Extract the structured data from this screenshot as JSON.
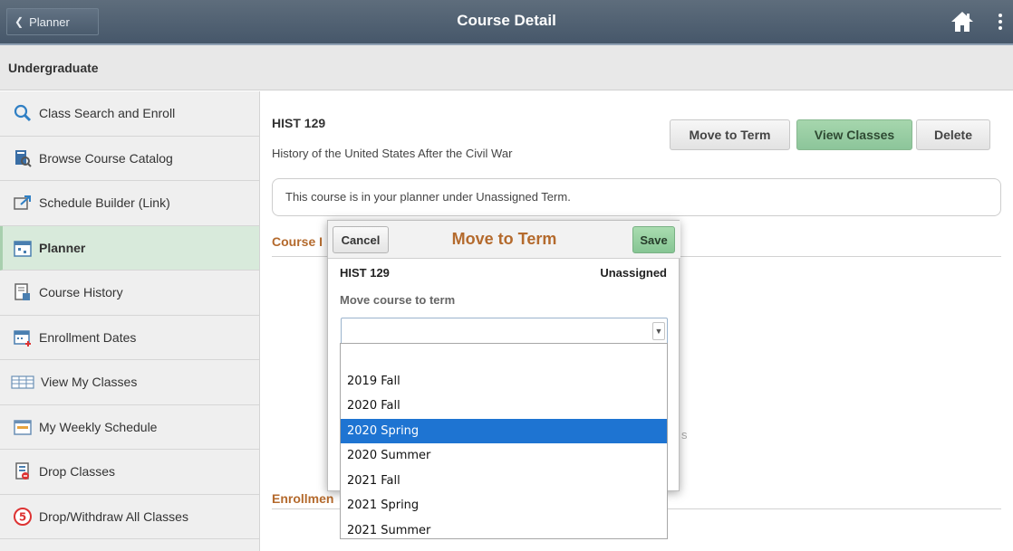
{
  "header": {
    "back_label": "Planner",
    "title": "Course Detail"
  },
  "subheader": {
    "label": "Undergraduate"
  },
  "sidebar": {
    "items": [
      {
        "label": "Class Search and Enroll",
        "icon": "search-icon"
      },
      {
        "label": "Browse Course Catalog",
        "icon": "catalog-icon"
      },
      {
        "label": "Schedule Builder (Link)",
        "icon": "external-link-icon"
      },
      {
        "label": "Planner",
        "icon": "planner-icon",
        "active": true
      },
      {
        "label": "Course History",
        "icon": "course-history-icon"
      },
      {
        "label": "Enrollment Dates",
        "icon": "calendar-plus-icon"
      },
      {
        "label": "View My Classes",
        "icon": "classes-icon"
      },
      {
        "label": "My Weekly Schedule",
        "icon": "weekly-schedule-icon"
      },
      {
        "label": "Drop Classes",
        "icon": "drop-icon"
      },
      {
        "label": "Drop/Withdraw All Classes",
        "icon": "withdraw-icon"
      }
    ]
  },
  "course": {
    "code": "HIST 129",
    "title": "History of the United States After the Civil War",
    "info": "This course is in your planner under Unassigned Term.",
    "section_1": "Course I",
    "section_2": "Enrollmen",
    "hidden_char": "s"
  },
  "actions": {
    "move": "Move to Term",
    "view": "View Classes",
    "delete": "Delete"
  },
  "modal": {
    "cancel": "Cancel",
    "title": "Move to Term",
    "save": "Save",
    "course_code": "HIST 129",
    "current_term": "Unassigned",
    "field_label": "Move course to term",
    "selected_value": ""
  },
  "dropdown": {
    "options": [
      "",
      "2019 Fall",
      "2020 Fall",
      "2020 Spring",
      "2020 Summer",
      "2021 Fall",
      "2021 Spring",
      "2021 Summer"
    ],
    "highlighted": "2020 Spring"
  },
  "colors": {
    "header_bg": "#4e5f71",
    "accent_orange": "#b46a2d",
    "active_nav": "#d8eadb",
    "green_button": "#8cc59a",
    "selection_blue": "#1e74d2"
  }
}
